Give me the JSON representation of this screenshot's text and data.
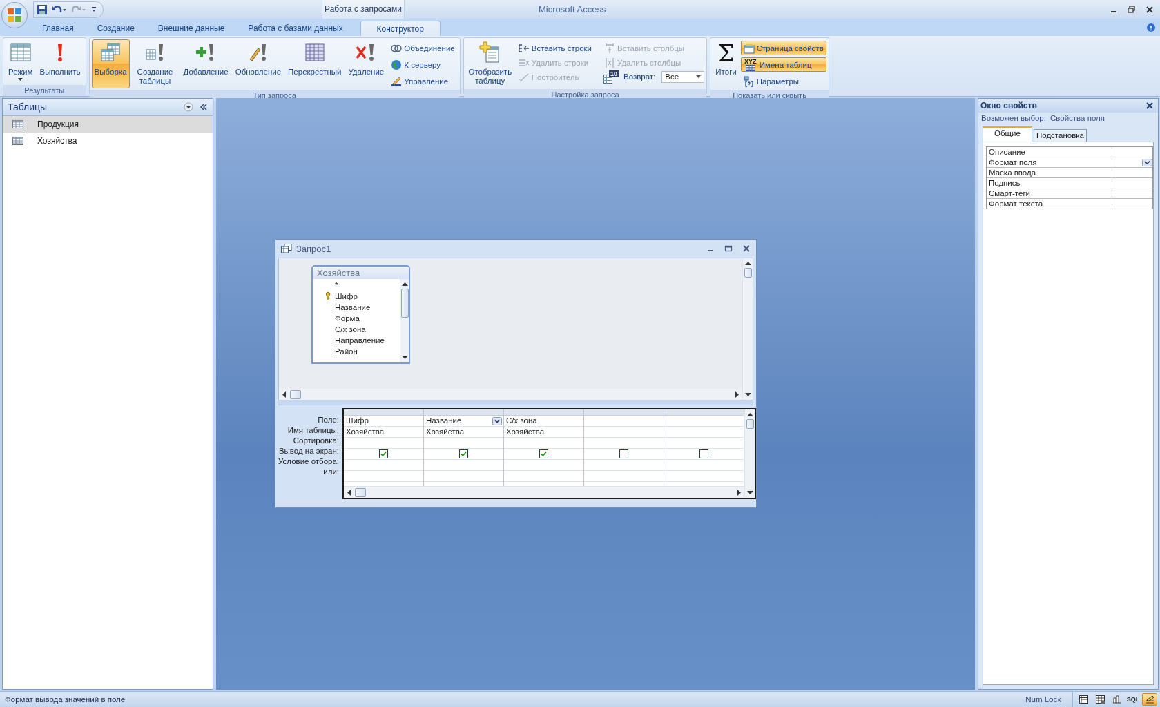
{
  "title_bar": {
    "title": "Microsoft Access",
    "context_label": "Работа с запросами"
  },
  "ribbon_tabs": [
    {
      "label": "Главная",
      "selected": false
    },
    {
      "label": "Создание",
      "selected": false
    },
    {
      "label": "Внешние данные",
      "selected": false
    },
    {
      "label": "Работа с базами данных",
      "selected": false
    },
    {
      "label": "Конструктор",
      "selected": true
    }
  ],
  "ribbon": {
    "groups": [
      {
        "label": "Результаты",
        "buttons": [
          {
            "label": "Режим",
            "selected": false
          },
          {
            "label": "Выполнить",
            "selected": false
          }
        ]
      },
      {
        "label": "Тип запроса",
        "buttons": [
          {
            "label": "Выборка",
            "selected": true
          },
          {
            "label": "Создание таблицы",
            "selected": false
          },
          {
            "label": "Добавление",
            "selected": false
          },
          {
            "label": "Обновление",
            "selected": false
          },
          {
            "label": "Перекрестный",
            "selected": false
          },
          {
            "label": "Удаление",
            "selected": false
          }
        ],
        "small_buttons": [
          {
            "label": "Объединение",
            "disabled": false
          },
          {
            "label": "К серверу",
            "disabled": false
          },
          {
            "label": "Управление",
            "disabled": false
          }
        ]
      },
      {
        "label": "Настройка запроса",
        "buttons": [
          {
            "label": "Отобразить таблицу",
            "selected": false
          }
        ],
        "small_buttons": [
          {
            "label": "Вставить строки",
            "disabled": false
          },
          {
            "label": "Удалить строки",
            "disabled": true
          },
          {
            "label": "Построитель",
            "disabled": true
          },
          {
            "label": "Вставить столбцы",
            "disabled": true
          },
          {
            "label": "Удалить столбцы",
            "disabled": true
          }
        ],
        "return": {
          "label": "Возврат:",
          "badge": "10",
          "value": "Все"
        }
      },
      {
        "label": "Показать или скрыть",
        "buttons": [
          {
            "label": "Итоги",
            "symbol": "Σ",
            "selected": false
          }
        ],
        "small_buttons": [
          {
            "label": "Страница свойств",
            "selected": true
          },
          {
            "label": "Имена таблиц",
            "badge": "XYZ",
            "selected": true
          },
          {
            "label": "Параметры",
            "selected": false
          }
        ]
      }
    ]
  },
  "navigation_pane": {
    "title": "Таблицы",
    "items": [
      {
        "label": "Продукция",
        "selected": true
      },
      {
        "label": "Хозяйства",
        "selected": false
      }
    ]
  },
  "query_window": {
    "title": "Запрос1",
    "table": {
      "title": "Хозяйства",
      "fields": [
        {
          "label": "*",
          "key": false
        },
        {
          "label": "Шифр",
          "key": true
        },
        {
          "label": "Название",
          "key": false
        },
        {
          "label": "Форма",
          "key": false
        },
        {
          "label": "С/х зона",
          "key": false
        },
        {
          "label": "Направление",
          "key": false
        },
        {
          "label": "Район",
          "key": false
        }
      ]
    },
    "grid": {
      "row_labels": [
        "Поле:",
        "Имя таблицы:",
        "Сортировка:",
        "Вывод на экран:",
        "Условие отбора:",
        "или:"
      ],
      "columns": [
        {
          "field": "Шифр",
          "table": "Хозяйства",
          "show": true,
          "selected": false
        },
        {
          "field": "Название",
          "table": "Хозяйства",
          "show": true,
          "selected": true
        },
        {
          "field": "С/х зона",
          "table": "Хозяйства",
          "show": true,
          "selected": false
        },
        {
          "show": false,
          "selected": false
        },
        {
          "show": false,
          "selected": false
        }
      ]
    }
  },
  "property_sheet": {
    "title": "Окно свойств",
    "selection_label": "Возможен выбор:",
    "selection_value": "Свойства поля",
    "tabs": [
      {
        "label": "Общие",
        "selected": true
      },
      {
        "label": "Подстановка",
        "selected": false
      }
    ],
    "properties": [
      {
        "label": "Описание",
        "selected": false
      },
      {
        "label": "Формат поля",
        "selected": true
      },
      {
        "label": "Маска ввода",
        "selected": false
      },
      {
        "label": "Подпись",
        "selected": false
      },
      {
        "label": "Смарт-теги",
        "selected": false
      },
      {
        "label": "Формат текста",
        "selected": false
      }
    ]
  },
  "status_bar": {
    "text": "Формат вывода значений в поле",
    "indicator": "Num Lock",
    "views": [
      {
        "kind": "datasheet",
        "selected": false
      },
      {
        "kind": "pivot_table",
        "selected": false
      },
      {
        "kind": "pivot_chart",
        "selected": false
      },
      {
        "kind": "sql",
        "label": "SQL",
        "selected": false
      },
      {
        "kind": "design",
        "selected": true
      }
    ]
  }
}
